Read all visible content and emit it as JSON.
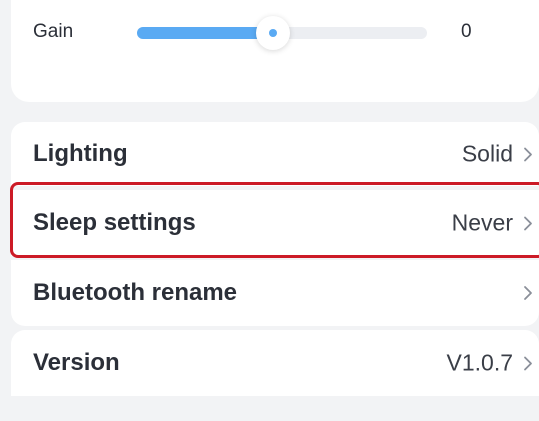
{
  "gain": {
    "label": "Gain",
    "value": "0",
    "slider_fraction": 0.47,
    "accent_color": "#5aaaf3"
  },
  "settings": {
    "rows": [
      {
        "label": "Lighting",
        "value": "Solid",
        "icon": "chevron-right-icon"
      },
      {
        "label": "Sleep settings",
        "value": "Never",
        "icon": "chevron-right-icon"
      },
      {
        "label": "Bluetooth rename",
        "value": "",
        "icon": "chevron-right-icon"
      },
      {
        "label": "Version",
        "value": "V1.0.7",
        "icon": "chevron-right-icon"
      }
    ]
  },
  "highlight": {
    "target": "Sleep settings",
    "color": "#cc1a26"
  }
}
